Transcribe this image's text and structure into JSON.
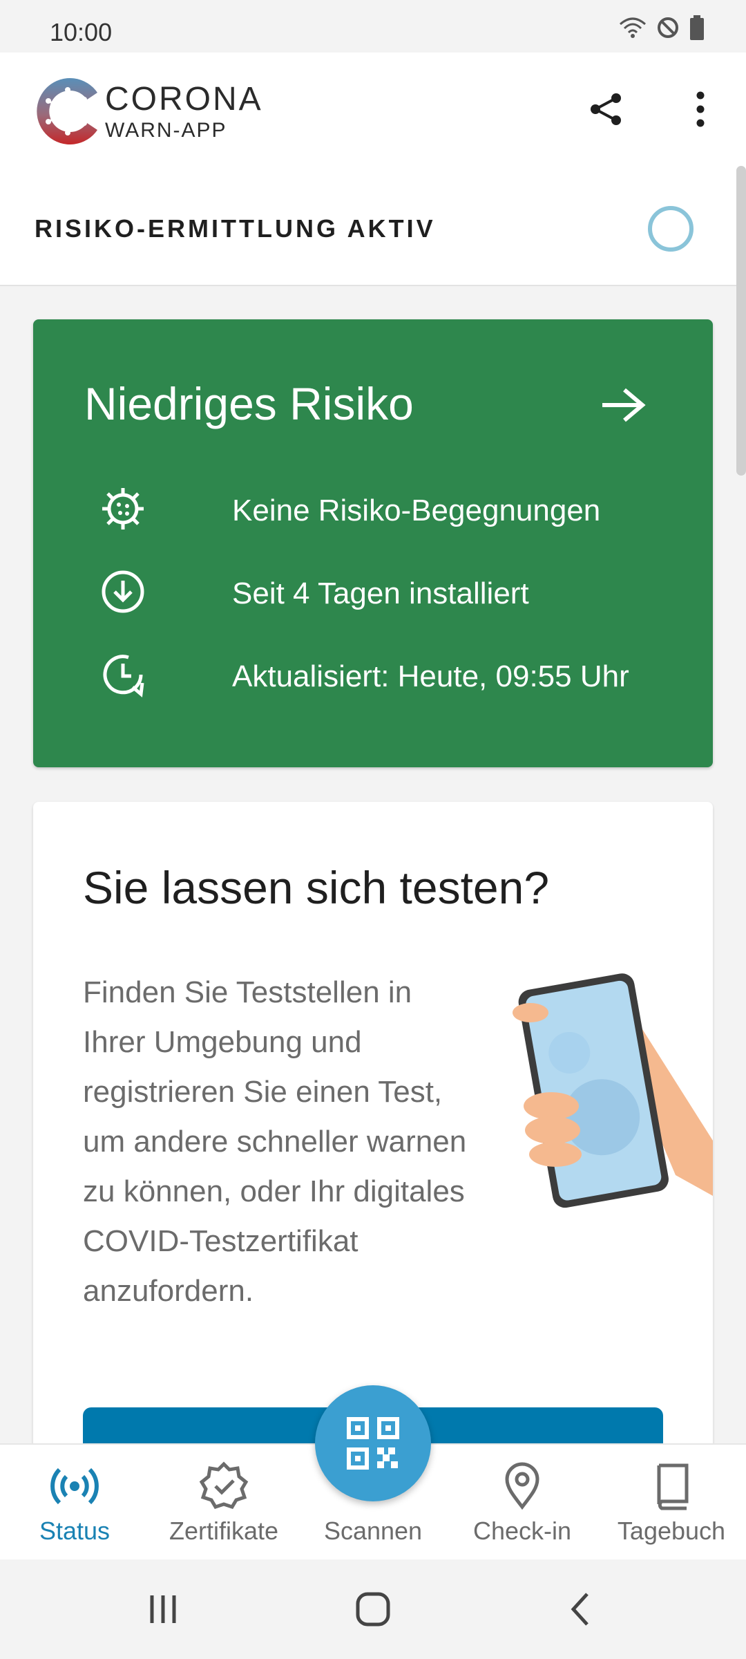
{
  "status_bar": {
    "time": "10:00",
    "icons": [
      "wifi-icon",
      "do-not-disturb-icon",
      "battery-icon"
    ]
  },
  "app_header": {
    "logo_line1": "CORONA",
    "logo_line2": "WARN-APP",
    "icons": [
      "share-icon",
      "more-vert-icon"
    ]
  },
  "risk_status": {
    "label": "RISIKO-ERMITTLUNG AKTIV"
  },
  "risk_card": {
    "title": "Niedriges Risiko",
    "color": "#2e874d",
    "items": [
      {
        "icon": "virus-icon",
        "text": "Keine Risiko-Begegnungen"
      },
      {
        "icon": "download-circle-icon",
        "text": "Seit 4 Tagen installiert"
      },
      {
        "icon": "clock-refresh-icon",
        "text": "Aktualisiert: Heute, 09:55 Uhr"
      }
    ]
  },
  "test_card": {
    "title": "Sie lassen sich testen?",
    "body": "Finden Sie Teststellen in Ihrer Umgebung und registrieren Sie einen Test, um andere schneller warnen zu können, oder Ihr digitales COVID-Testzertifikat anzufordern."
  },
  "bottom_nav": {
    "items": [
      {
        "label": "Status",
        "icon": "broadcast-icon",
        "active": true
      },
      {
        "label": "Zertifikate",
        "icon": "certificate-badge-icon",
        "active": false
      },
      {
        "label": "Scannen",
        "icon": "qr-code-icon",
        "active": false
      },
      {
        "label": "Check-in",
        "icon": "location-pin-icon",
        "active": false
      },
      {
        "label": "Tagebuch",
        "icon": "book-icon",
        "active": false
      }
    ],
    "accent": "#1a82b3"
  },
  "system_nav": {
    "icons": [
      "recents-icon",
      "home-icon",
      "back-icon"
    ]
  }
}
